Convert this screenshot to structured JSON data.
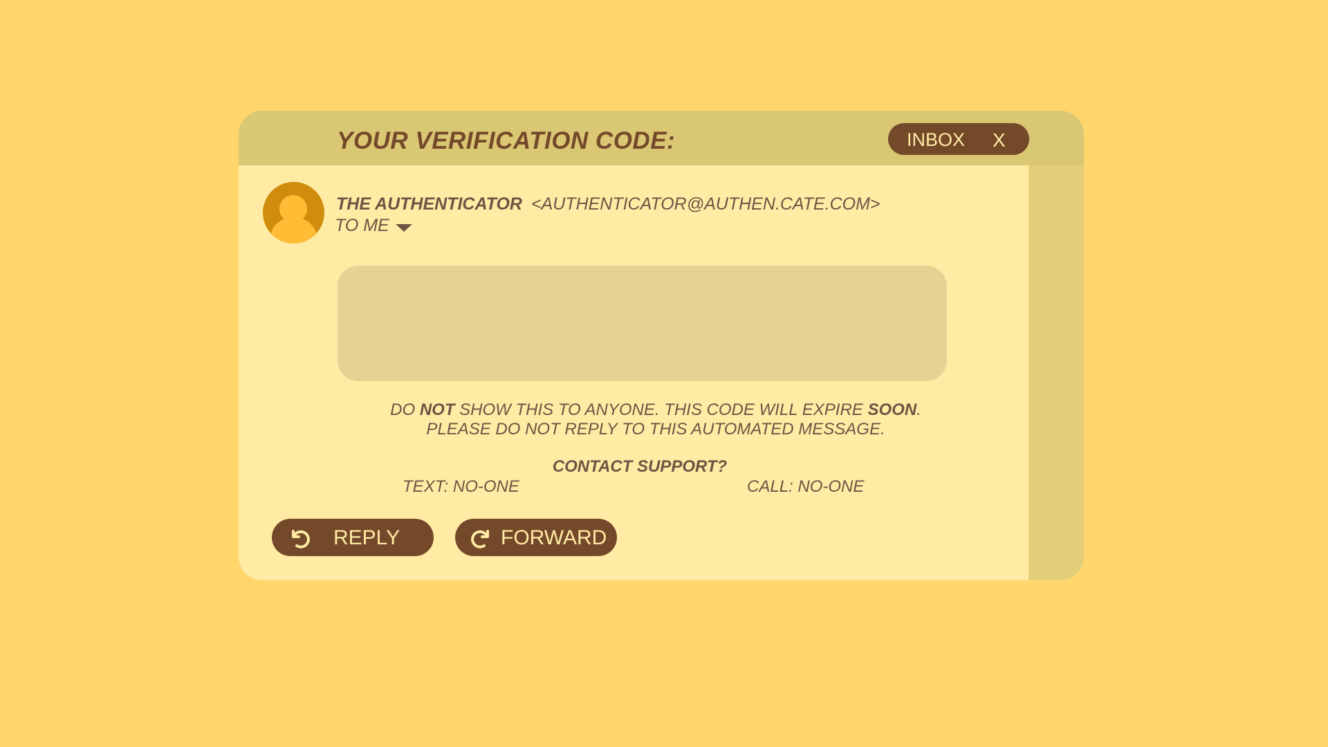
{
  "window": {
    "title": "YOUR VERIFICATION CODE:",
    "inbox_label": "INBOX",
    "close_label": "X"
  },
  "message": {
    "sender_name": "THE AUTHENTICATOR",
    "sender_email": "<AUTHENTICATOR@AUTHEN.CATE.COM>",
    "to_label": "TO ME",
    "avatar_icon": "user-avatar-icon",
    "code_value": "",
    "warning": {
      "part1": "DO ",
      "bold1": "NOT",
      "part2": " SHOW THIS TO ANYONE. THIS CODE WILL EXPIRE ",
      "bold2": "SOON",
      "part3": ".",
      "line2": "PLEASE DO NOT REPLY TO THIS AUTOMATED MESSAGE."
    },
    "contact": {
      "title": "CONTACT SUPPORT?",
      "text": "TEXT: NO-ONE",
      "call": "CALL: NO-ONE"
    }
  },
  "actions": {
    "reply_label": "REPLY",
    "forward_label": "FORWARD"
  },
  "colors": {
    "background": "#ffd56c",
    "window": "#ffeba4",
    "titlebar": "#dac774",
    "accent": "#74492a",
    "text": "#6d5544",
    "avatar": "#d08c0c"
  }
}
